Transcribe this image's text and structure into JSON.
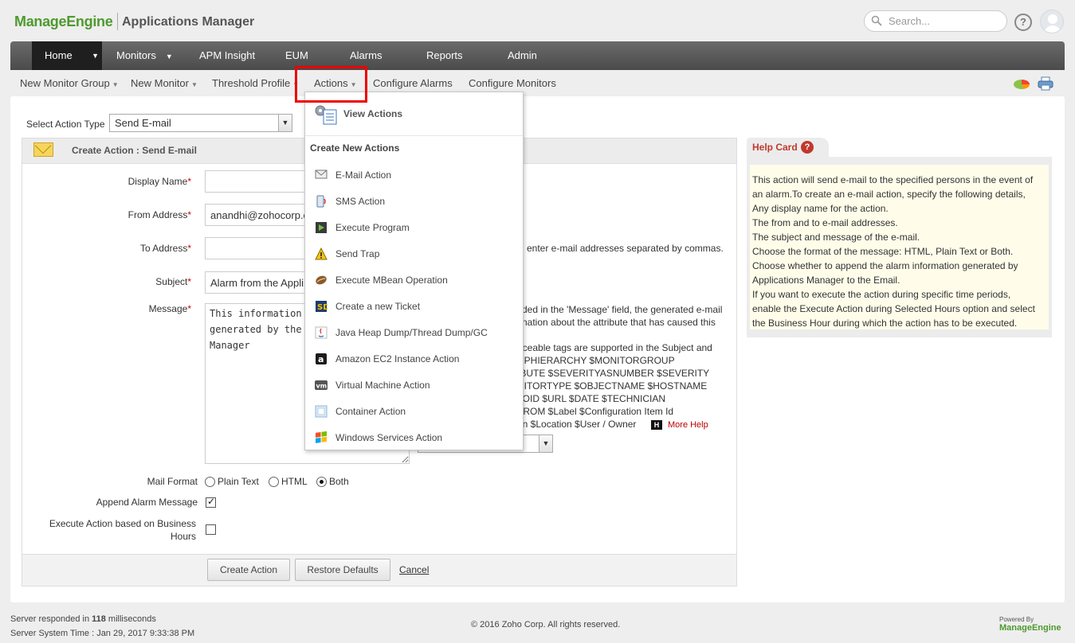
{
  "brand": {
    "logo_part1": "Manage",
    "logo_part2": "Engine",
    "app_name": "Applications Manager"
  },
  "header": {
    "search_placeholder": "Search..."
  },
  "nav": {
    "items": [
      "Home",
      "Monitors",
      "APM Insight",
      "EUM",
      "Alarms",
      "Reports",
      "Admin"
    ]
  },
  "subnav": {
    "items": [
      "New Monitor Group",
      "New Monitor",
      "Threshold Profile",
      "Actions",
      "Configure Alarms",
      "Configure Monitors"
    ]
  },
  "form": {
    "select_action_label": "Select Action Type",
    "select_action_value": "Send E-mail",
    "title": "Create Action : Send E-mail",
    "display_name_label": "Display Name",
    "from_address_label": "From Address",
    "from_address_value": "anandhi@zohocorp.c",
    "to_address_label": "To Address",
    "to_address_hint": "enter e-mail addresses separated by commas.",
    "subject_label": "Subject",
    "subject_value": "Alarm from the Appli",
    "message_label": "Message",
    "message_value": "This information\ngenerated by the\nManager",
    "message_hint": [
      "ded in the 'Message' field, the generated e-mail",
      "nation about the attribute that has caused this"
    ],
    "tags_text": [
      "aceable tags are supported in the Subject and",
      "UPHIERARCHY $MONITORGROUP",
      "IBUTE $SEVERITYASNUMBER $SEVERITY",
      "NITORTYPE $OBJECTNAME $HOSTNAME",
      "$OID $URL $DATE $TECHNICIAN",
      "FROM $Label $Configuration Item Id",
      "on $Location $User / Owner"
    ],
    "more_help": "More Help",
    "mail_format_label": "Mail Format",
    "mail_format_options": [
      "Plain Text",
      "HTML",
      "Both"
    ],
    "mail_format_selected": "Both",
    "append_alarm_label": "Append Alarm Message",
    "append_alarm_checked": true,
    "business_hours_label": [
      "Execute Action based on Business",
      "Hours"
    ],
    "business_hours_checked": false,
    "create_button": "Create Action",
    "restore_button": "Restore Defaults",
    "cancel_link": "Cancel"
  },
  "help_card": {
    "title": "Help Card",
    "lines": [
      "This action will send e-mail to the specified persons in the event of",
      "an alarm.To create an e-mail action, specify the following details,",
      "Any display name for the action.",
      "The from and to e-mail addresses.",
      "The subject and message of the e-mail.",
      "Choose the format of the message: HTML, Plain Text or Both.",
      "Choose whether to append the alarm information generated by",
      "Applications Manager to the Email.",
      "If you want to execute the action during specific time periods,",
      "enable the Execute Action during Selected Hours option and select",
      "the Business Hour during which the action has to be executed."
    ]
  },
  "actions_menu": {
    "view_actions": "View Actions",
    "create_heading": "Create New Actions",
    "items": [
      {
        "label": "E-Mail Action",
        "icon": "mail-icon"
      },
      {
        "label": "SMS Action",
        "icon": "sms-icon"
      },
      {
        "label": "Execute Program",
        "icon": "program-icon"
      },
      {
        "label": "Send Trap",
        "icon": "warning-icon"
      },
      {
        "label": "Execute MBean Operation",
        "icon": "mbean-icon"
      },
      {
        "label": "Create a new Ticket",
        "icon": "ticket-icon"
      },
      {
        "label": "Java Heap Dump/Thread Dump/GC",
        "icon": "java-icon"
      },
      {
        "label": "Amazon EC2 Instance Action",
        "icon": "amazon-icon"
      },
      {
        "label": "Virtual Machine Action",
        "icon": "vm-icon"
      },
      {
        "label": "Container Action",
        "icon": "container-icon"
      },
      {
        "label": "Windows Services Action",
        "icon": "windows-icon"
      }
    ]
  },
  "footer": {
    "response_prefix": "Server responded in ",
    "response_ms": "118",
    "response_suffix": " milliseconds",
    "server_time": "Server System Time : Jan 29, 2017 9:33:38 PM",
    "copyright": "© 2016 Zoho Corp.    All rights reserved.",
    "powered_by": "Powered By",
    "powered_brand": "ManageEngine"
  }
}
